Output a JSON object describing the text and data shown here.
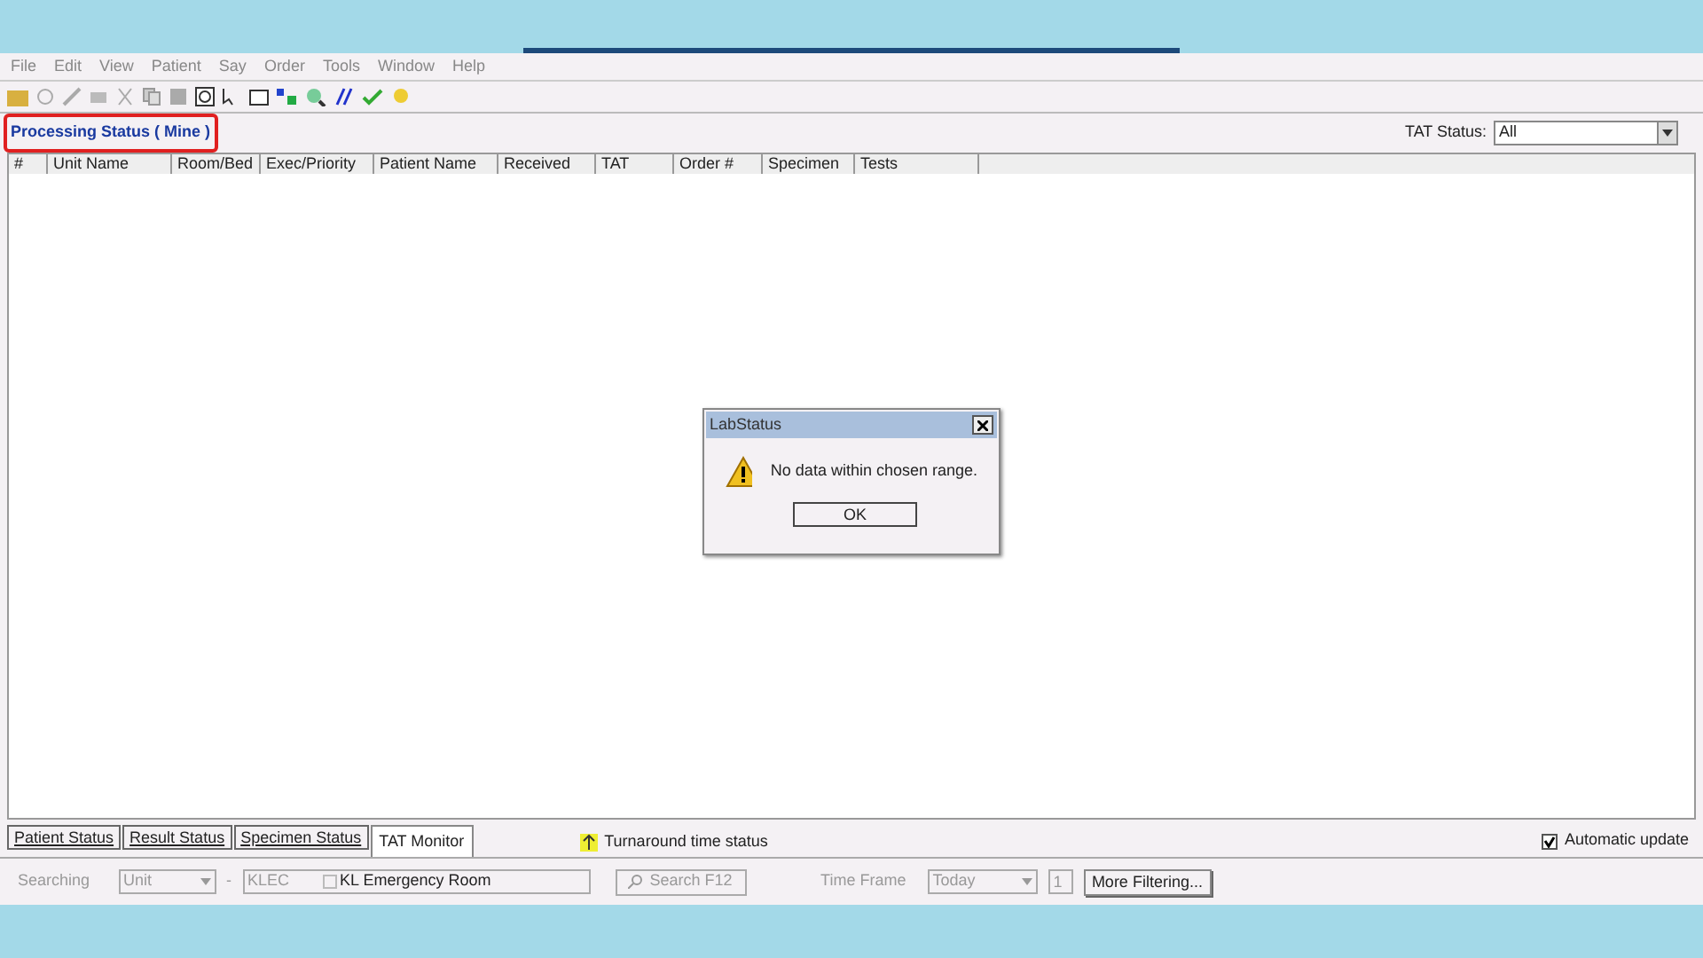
{
  "menu": [
    "File",
    "Edit",
    "View",
    "Patient",
    "Say",
    "Order",
    "Tools",
    "Window",
    "Help"
  ],
  "view_title": "Processing Status ( Mine )",
  "tat_status": {
    "label": "TAT Status:",
    "value": "All"
  },
  "table": {
    "columns": [
      "#",
      "Unit Name",
      "Room/Bed",
      "Exec/Priority",
      "Patient Name",
      "Received",
      "TAT",
      "Order #",
      "Specimen",
      "Tests"
    ]
  },
  "dialog": {
    "title": "LabStatus",
    "message": "No data within chosen range.",
    "button": "OK"
  },
  "tabs": [
    {
      "label": "Patient Status",
      "selected": false
    },
    {
      "label": "Result Status",
      "selected": false
    },
    {
      "label": "Specimen Status",
      "selected": false
    },
    {
      "label": "TAT Monitor",
      "selected": true
    }
  ],
  "legend": "Turnaround time status",
  "automatic_update": {
    "label": "Automatic update",
    "checked": true
  },
  "filters": {
    "searching_label": "Searching",
    "searching_value": "Unit",
    "dash": "-",
    "unit_code": "KLEC",
    "unit_name": "KL Emergency Room",
    "search_button": "Search F12",
    "time_frame_label": "Time Frame",
    "time_frame_value": "Today",
    "count": "1",
    "more_button": "More Filtering..."
  }
}
